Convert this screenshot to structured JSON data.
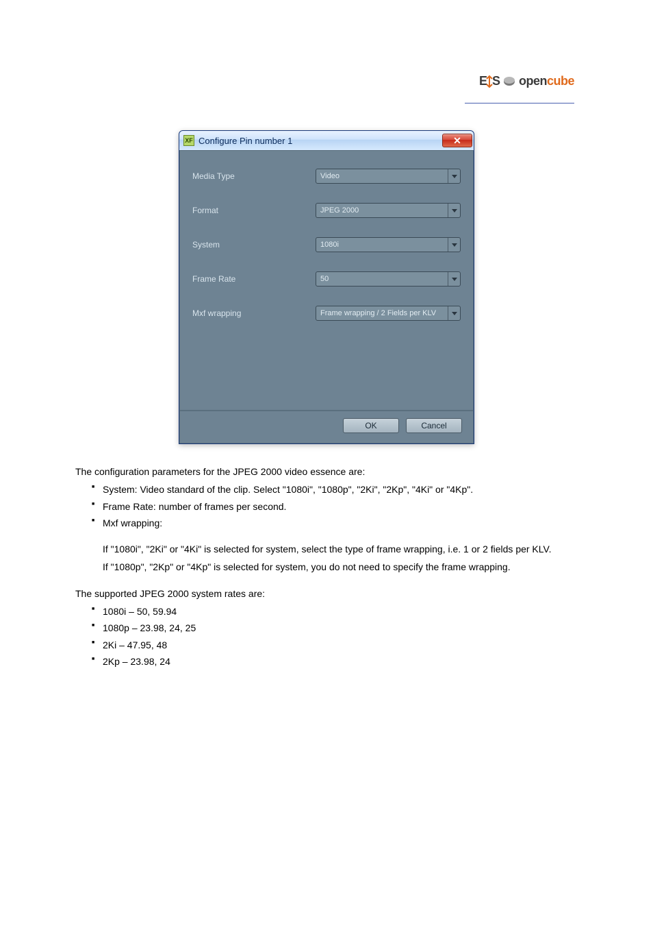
{
  "logo": {
    "evs": "EVS",
    "opencube_op": "open",
    "opencube_cu": "cube"
  },
  "dialog": {
    "title": "Configure Pin number 1",
    "close_glyph": "✕",
    "icon_text": "XF",
    "fields": [
      {
        "label": "Media Type",
        "value": "Video"
      },
      {
        "label": "Format",
        "value": "JPEG 2000"
      },
      {
        "label": "System",
        "value": "1080i"
      },
      {
        "label": "Frame Rate",
        "value": "50"
      },
      {
        "label": "Mxf wrapping",
        "value": "Frame wrapping / 2 Fields per KLV"
      }
    ],
    "ok": "OK",
    "cancel": "Cancel"
  },
  "doc": {
    "intro": "The configuration parameters for the JPEG 2000 video essence are:",
    "b1": "System: Video standard of the clip. Select \"1080i\", \"1080p\", \"2Ki\", \"2Kp\", \"4Ki\" or \"4Kp\".",
    "b2": "Frame Rate: number of frames per second.",
    "b3": "Mxf wrapping:",
    "mxf_intro": "If \"1080i\", \"2Ki\" or \"4Ki\" is selected for system, select the type of frame wrapping, i.e. 1 or 2 fields per KLV.",
    "mxf_note": "If \"1080p\", \"2Kp\" or \"4Kp\" is selected for system, you do not need to specify the frame wrapping.",
    "sr_intro": "The supported JPEG 2000 system rates are:",
    "sr": [
      "1080i – 50, 59.94",
      "1080p – 23.98, 24, 25",
      "2Ki – 47.95, 48",
      "2Kp – 23.98, 24"
    ]
  }
}
